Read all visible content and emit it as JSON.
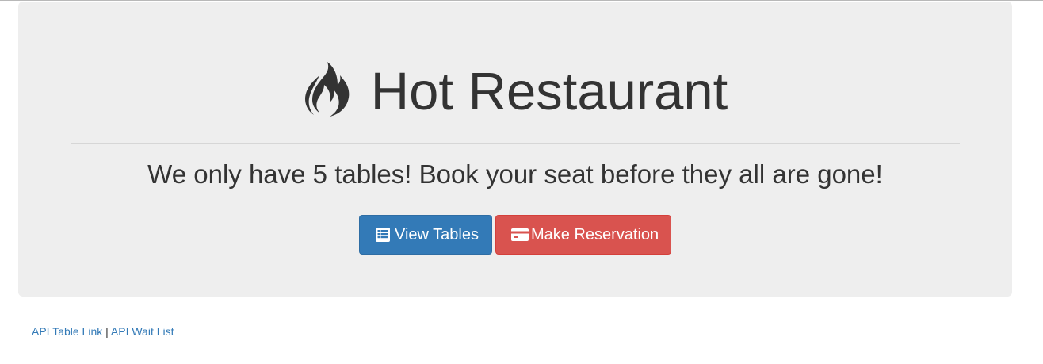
{
  "header": {
    "title": "Hot Restaurant",
    "icon": "fire-icon",
    "tagline": "We only have 5 tables! Book your seat before they all are gone!"
  },
  "buttons": {
    "view_tables": {
      "label": "View Tables",
      "icon": "list-alt-icon",
      "color": "#337ab7"
    },
    "make_reservation": {
      "label": "Make Reservation",
      "icon": "credit-card-icon",
      "color": "#d9534f"
    }
  },
  "footer": {
    "table_link": "API Table Link",
    "separator": "|",
    "wait_list_link": "API Wait List",
    "link_color": "#337ab7"
  },
  "colors": {
    "jumbotron_bg": "#eeeeee",
    "text": "#333333"
  }
}
